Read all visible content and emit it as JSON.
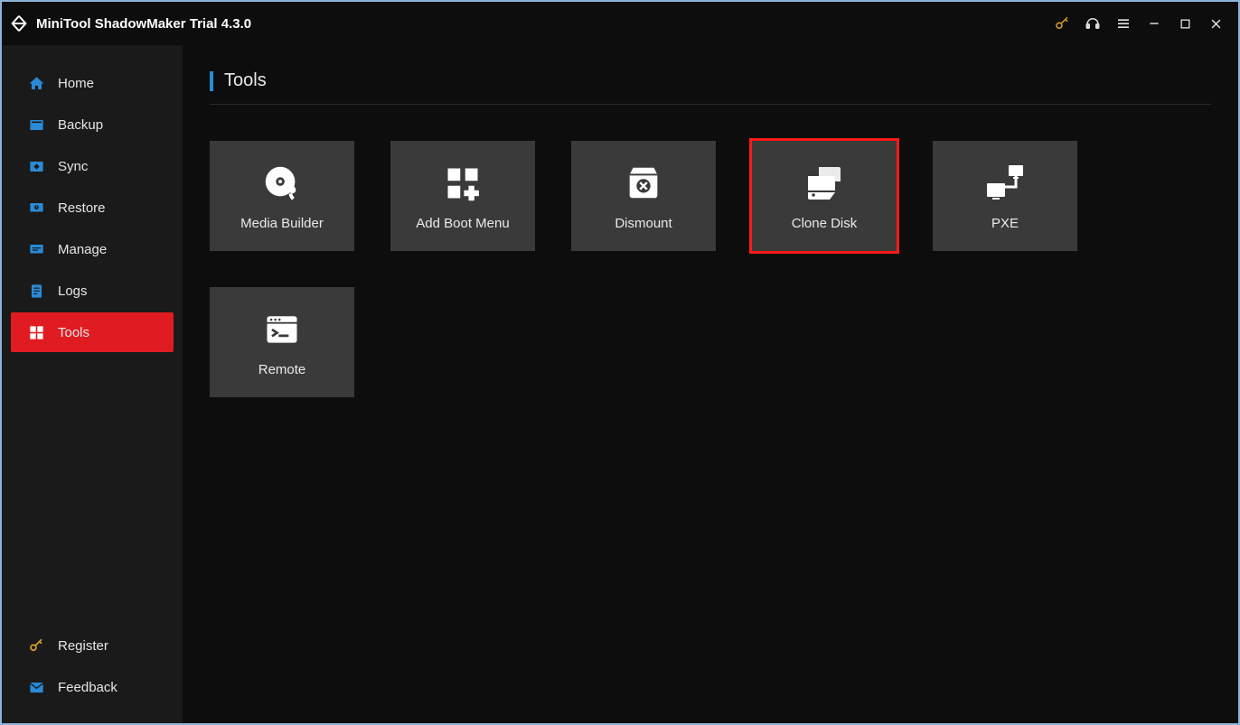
{
  "app": {
    "title": "MiniTool ShadowMaker Trial 4.3.0"
  },
  "sidebar": {
    "items": [
      {
        "label": "Home"
      },
      {
        "label": "Backup"
      },
      {
        "label": "Sync"
      },
      {
        "label": "Restore"
      },
      {
        "label": "Manage"
      },
      {
        "label": "Logs"
      },
      {
        "label": "Tools"
      }
    ],
    "footer": {
      "register": "Register",
      "feedback": "Feedback"
    }
  },
  "page": {
    "title": "Tools",
    "tiles": [
      {
        "label": "Media Builder"
      },
      {
        "label": "Add Boot Menu"
      },
      {
        "label": "Dismount"
      },
      {
        "label": "Clone Disk",
        "highlight": true
      },
      {
        "label": "PXE"
      },
      {
        "label": "Remote"
      }
    ]
  }
}
